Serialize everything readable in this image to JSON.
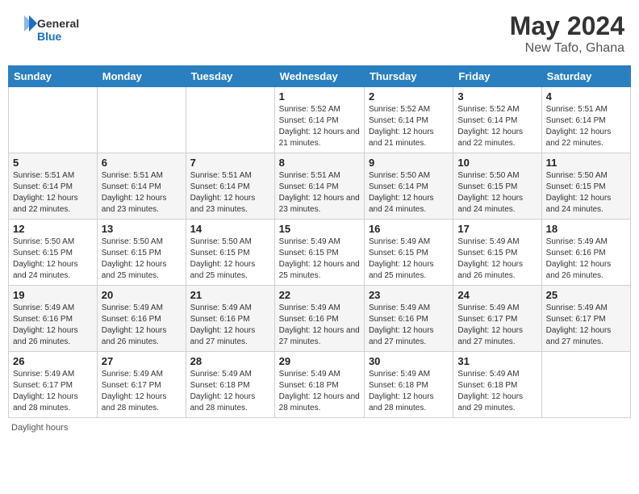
{
  "header": {
    "logo_general": "General",
    "logo_blue": "Blue",
    "month_year": "May 2024",
    "location": "New Tafo, Ghana"
  },
  "days_of_week": [
    "Sunday",
    "Monday",
    "Tuesday",
    "Wednesday",
    "Thursday",
    "Friday",
    "Saturday"
  ],
  "weeks": [
    [
      {
        "day": "",
        "sunrise": "",
        "sunset": "",
        "daylight": ""
      },
      {
        "day": "",
        "sunrise": "",
        "sunset": "",
        "daylight": ""
      },
      {
        "day": "",
        "sunrise": "",
        "sunset": "",
        "daylight": ""
      },
      {
        "day": "1",
        "sunrise": "5:52 AM",
        "sunset": "6:14 PM",
        "daylight": "12 hours and 21 minutes."
      },
      {
        "day": "2",
        "sunrise": "5:52 AM",
        "sunset": "6:14 PM",
        "daylight": "12 hours and 21 minutes."
      },
      {
        "day": "3",
        "sunrise": "5:52 AM",
        "sunset": "6:14 PM",
        "daylight": "12 hours and 22 minutes."
      },
      {
        "day": "4",
        "sunrise": "5:51 AM",
        "sunset": "6:14 PM",
        "daylight": "12 hours and 22 minutes."
      }
    ],
    [
      {
        "day": "5",
        "sunrise": "5:51 AM",
        "sunset": "6:14 PM",
        "daylight": "12 hours and 22 minutes."
      },
      {
        "day": "6",
        "sunrise": "5:51 AM",
        "sunset": "6:14 PM",
        "daylight": "12 hours and 23 minutes."
      },
      {
        "day": "7",
        "sunrise": "5:51 AM",
        "sunset": "6:14 PM",
        "daylight": "12 hours and 23 minutes."
      },
      {
        "day": "8",
        "sunrise": "5:51 AM",
        "sunset": "6:14 PM",
        "daylight": "12 hours and 23 minutes."
      },
      {
        "day": "9",
        "sunrise": "5:50 AM",
        "sunset": "6:14 PM",
        "daylight": "12 hours and 24 minutes."
      },
      {
        "day": "10",
        "sunrise": "5:50 AM",
        "sunset": "6:15 PM",
        "daylight": "12 hours and 24 minutes."
      },
      {
        "day": "11",
        "sunrise": "5:50 AM",
        "sunset": "6:15 PM",
        "daylight": "12 hours and 24 minutes."
      }
    ],
    [
      {
        "day": "12",
        "sunrise": "5:50 AM",
        "sunset": "6:15 PM",
        "daylight": "12 hours and 24 minutes."
      },
      {
        "day": "13",
        "sunrise": "5:50 AM",
        "sunset": "6:15 PM",
        "daylight": "12 hours and 25 minutes."
      },
      {
        "day": "14",
        "sunrise": "5:50 AM",
        "sunset": "6:15 PM",
        "daylight": "12 hours and 25 minutes."
      },
      {
        "day": "15",
        "sunrise": "5:49 AM",
        "sunset": "6:15 PM",
        "daylight": "12 hours and 25 minutes."
      },
      {
        "day": "16",
        "sunrise": "5:49 AM",
        "sunset": "6:15 PM",
        "daylight": "12 hours and 25 minutes."
      },
      {
        "day": "17",
        "sunrise": "5:49 AM",
        "sunset": "6:15 PM",
        "daylight": "12 hours and 26 minutes."
      },
      {
        "day": "18",
        "sunrise": "5:49 AM",
        "sunset": "6:16 PM",
        "daylight": "12 hours and 26 minutes."
      }
    ],
    [
      {
        "day": "19",
        "sunrise": "5:49 AM",
        "sunset": "6:16 PM",
        "daylight": "12 hours and 26 minutes."
      },
      {
        "day": "20",
        "sunrise": "5:49 AM",
        "sunset": "6:16 PM",
        "daylight": "12 hours and 26 minutes."
      },
      {
        "day": "21",
        "sunrise": "5:49 AM",
        "sunset": "6:16 PM",
        "daylight": "12 hours and 27 minutes."
      },
      {
        "day": "22",
        "sunrise": "5:49 AM",
        "sunset": "6:16 PM",
        "daylight": "12 hours and 27 minutes."
      },
      {
        "day": "23",
        "sunrise": "5:49 AM",
        "sunset": "6:16 PM",
        "daylight": "12 hours and 27 minutes."
      },
      {
        "day": "24",
        "sunrise": "5:49 AM",
        "sunset": "6:17 PM",
        "daylight": "12 hours and 27 minutes."
      },
      {
        "day": "25",
        "sunrise": "5:49 AM",
        "sunset": "6:17 PM",
        "daylight": "12 hours and 27 minutes."
      }
    ],
    [
      {
        "day": "26",
        "sunrise": "5:49 AM",
        "sunset": "6:17 PM",
        "daylight": "12 hours and 28 minutes."
      },
      {
        "day": "27",
        "sunrise": "5:49 AM",
        "sunset": "6:17 PM",
        "daylight": "12 hours and 28 minutes."
      },
      {
        "day": "28",
        "sunrise": "5:49 AM",
        "sunset": "6:18 PM",
        "daylight": "12 hours and 28 minutes."
      },
      {
        "day": "29",
        "sunrise": "5:49 AM",
        "sunset": "6:18 PM",
        "daylight": "12 hours and 28 minutes."
      },
      {
        "day": "30",
        "sunrise": "5:49 AM",
        "sunset": "6:18 PM",
        "daylight": "12 hours and 28 minutes."
      },
      {
        "day": "31",
        "sunrise": "5:49 AM",
        "sunset": "6:18 PM",
        "daylight": "12 hours and 29 minutes."
      },
      {
        "day": "",
        "sunrise": "",
        "sunset": "",
        "daylight": ""
      }
    ]
  ],
  "footer": {
    "note": "Daylight hours"
  }
}
